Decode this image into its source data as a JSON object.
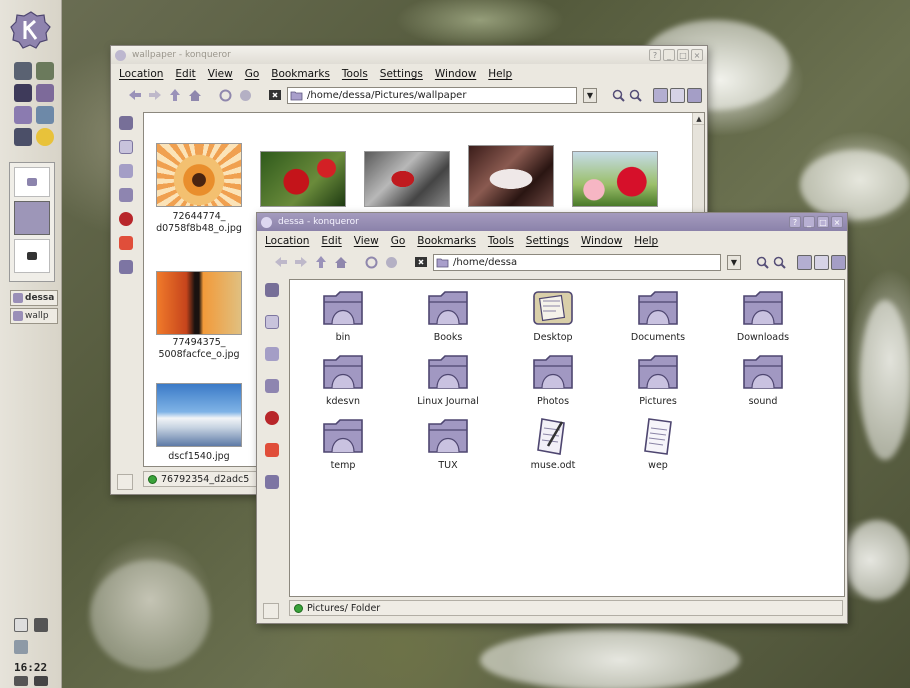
{
  "panel": {
    "clock": "16:22",
    "tasks": [
      "dessa",
      "wallp"
    ]
  },
  "back_window": {
    "title": "wallpaper - konqueror",
    "menu": [
      "Location",
      "Edit",
      "View",
      "Go",
      "Bookmarks",
      "Tools",
      "Settings",
      "Window",
      "Help"
    ],
    "location": "/home/dessa/Pictures/wallpaper",
    "thumbnails": [
      {
        "label": "72644774_\nd0758f8b48_o.jpg"
      },
      {
        "label": ""
      },
      {
        "label": ""
      },
      {
        "label": ""
      },
      {
        "label": ""
      },
      {
        "label": "77494375_\n5008facfce_o.jpg"
      },
      {
        "label": "dscf1540.jpg"
      }
    ],
    "status": "76792354_d2adc5"
  },
  "front_window": {
    "title": "dessa - konqueror",
    "menu": [
      "Location",
      "Edit",
      "View",
      "Go",
      "Bookmarks",
      "Tools",
      "Settings",
      "Window",
      "Help"
    ],
    "location": "/home/dessa",
    "items": [
      {
        "label": "bin",
        "icon": "folder-icon"
      },
      {
        "label": "Books",
        "icon": "folder-icon"
      },
      {
        "label": "Desktop",
        "icon": "desktop-folder-icon"
      },
      {
        "label": "Documents",
        "icon": "folder-icon"
      },
      {
        "label": "Downloads",
        "icon": "folder-icon"
      },
      {
        "label": "kdesvn",
        "icon": "folder-icon"
      },
      {
        "label": "Linux Journal",
        "icon": "folder-icon"
      },
      {
        "label": "Photos",
        "icon": "folder-icon"
      },
      {
        "label": "Pictures",
        "icon": "folder-icon"
      },
      {
        "label": "sound",
        "icon": "folder-icon"
      },
      {
        "label": "temp",
        "icon": "folder-icon"
      },
      {
        "label": "TUX",
        "icon": "folder-icon"
      },
      {
        "label": "muse.odt",
        "icon": "document-icon"
      },
      {
        "label": "wep",
        "icon": "text-file-icon"
      }
    ],
    "status": "Pictures/  Folder"
  }
}
